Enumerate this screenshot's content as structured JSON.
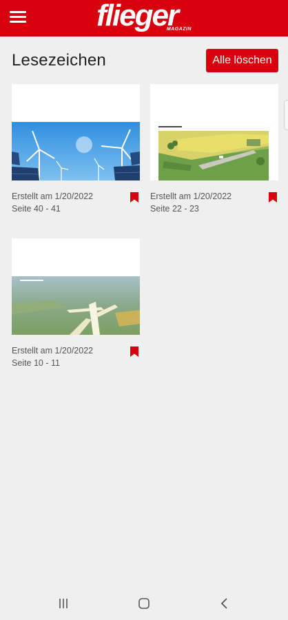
{
  "app": {
    "logo_text": "flieger",
    "logo_sub": "MAGAZIN",
    "brand_color": "#d9000d"
  },
  "header": {
    "menu_icon": "hamburger-menu-icon"
  },
  "page": {
    "title": "Lesezeichen",
    "clear_all_label": "Alle löschen"
  },
  "bookmarks": [
    {
      "created": "Erstellt am 1/20/2022",
      "pages": "Seite 40 - 41",
      "image": "wind turbines and solar panels",
      "icon": "bookmark-icon"
    },
    {
      "created": "Erstellt am 1/20/2022",
      "pages": "Seite 22 - 23",
      "image": "aerial view of airfield and fields",
      "icon": "bookmark-icon"
    },
    {
      "created": "Erstellt am 1/20/2022",
      "pages": "Seite 10 - 11",
      "image": "glider over landscape",
      "icon": "bookmark-icon"
    }
  ],
  "system_nav": {
    "recents_icon": "recents-icon",
    "home_icon": "home-icon",
    "back_icon": "back-icon"
  }
}
